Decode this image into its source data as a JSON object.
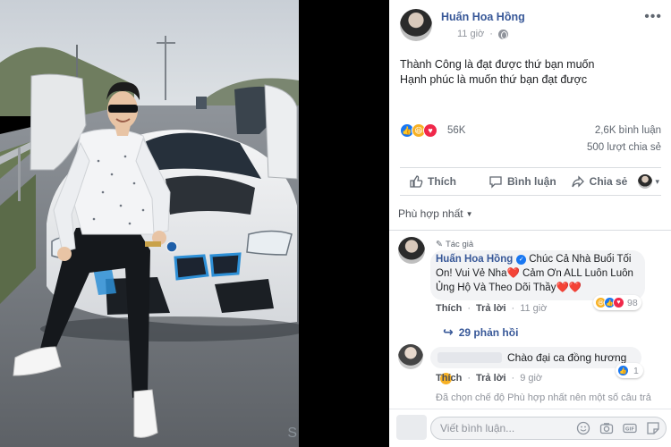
{
  "photo": {
    "watermark": "S"
  },
  "post": {
    "author": "Huấn Hoa Hồng",
    "time": "11 giờ",
    "body_line1": "Thành Công là đạt được thứ bạn muốn",
    "body_line2": "Hạnh phúc là muốn thứ bạn đạt được",
    "reaction_count": "56K",
    "comment_count": "2,6K bình luận",
    "share_count": "500 lượt chia sẻ",
    "more_icon": "ellipsis-icon",
    "privacy_icon": "globe-icon"
  },
  "actions": {
    "like": "Thích",
    "comment": "Bình luận",
    "share": "Chia sẻ"
  },
  "sort": {
    "label": "Phù hợp nhất"
  },
  "comments": [
    {
      "badge": "Tác giả",
      "name": "Huấn Hoa Hồng",
      "text": "Chúc Cả Nhà Buổi Tối On! Vui Vẻ Nha❤️ Cảm Ơn ALL Luôn Luôn Ủng Hộ Và Theo Dõi Thầy❤️❤️",
      "like": "Thích",
      "reply": "Trả lời",
      "time": "11 giờ",
      "reaction_count": "98"
    },
    {
      "text": "Chào đại ca đồng hương",
      "like": "Thích",
      "reply": "Trả lời",
      "time": "9 giờ",
      "reaction_count": "1"
    }
  ],
  "replies": {
    "label": "29 phản hồi"
  },
  "filter_note": "Đã chọn chế độ Phù hợp nhất nên một số câu trả",
  "composer": {
    "placeholder": "Viết bình luận..."
  },
  "colors": {
    "link_blue": "#385898",
    "like_blue": "#1877f2",
    "love_red": "#f0284a",
    "haha_yellow": "#f7b125"
  }
}
